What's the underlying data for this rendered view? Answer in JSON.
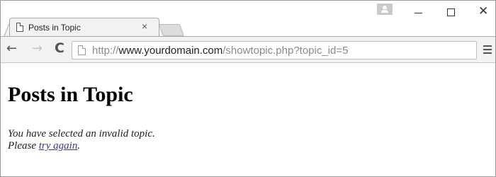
{
  "tab": {
    "title": "Posts in Topic",
    "close_glyph": "×"
  },
  "window_controls": {
    "minimize_label": "",
    "maximize_label": "",
    "close_glyph": "✕"
  },
  "toolbar": {
    "back_glyph": "←",
    "forward_glyph": "→",
    "reload_glyph": "C",
    "url_scheme": "http://",
    "url_host": "www.yourdomain.com",
    "url_path": "/showtopic.php?topic_id=5"
  },
  "page": {
    "heading": "Posts in Topic",
    "message_line1": "You have selected an invalid topic.",
    "message_line2_prefix": "Please ",
    "message_link": "try again",
    "message_line2_suffix": "."
  },
  "icons": {
    "tab_icon": "page-icon",
    "omnibox_icon": "page-icon",
    "menu_icon": "hamburger-menu-icon",
    "profile_icon": "user-profile-icon"
  },
  "colors": {
    "link": "#4b2a9c",
    "toolbar_bg": "#f2f2f2",
    "url_dim": "#8a8a8a"
  }
}
